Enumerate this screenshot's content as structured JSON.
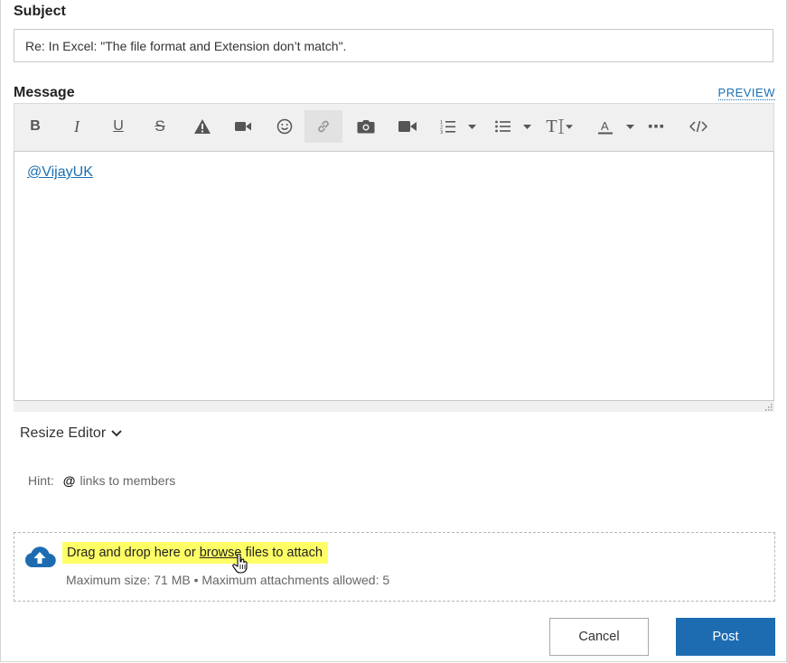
{
  "form": {
    "subject_label": "Subject",
    "subject_value": "Re: In Excel: \"The file format and Extension don’t match\".",
    "message_label": "Message",
    "preview_label": "PREVIEW"
  },
  "toolbar": {
    "items": [
      "bold",
      "italic",
      "underline",
      "strikethrough",
      "spoiler",
      "video",
      "emoji",
      "link",
      "photo",
      "video",
      "numbered-list",
      "bulleted-list",
      "text-size",
      "text-color",
      "more",
      "source-code"
    ],
    "bold": "B",
    "italic": "I",
    "underline": "U",
    "strike": "S",
    "text_size": "T"
  },
  "editor": {
    "mention": "@VijayUK"
  },
  "resize_editor_label": "Resize Editor",
  "hint": {
    "label": "Hint:",
    "symbol": "@",
    "text": "links to members"
  },
  "attach": {
    "text_before": "Drag and drop here or ",
    "browse": "browse",
    "text_after": " files to attach",
    "limits": "Maximum size: 71 MB • Maximum attachments allowed: 5"
  },
  "buttons": {
    "cancel": "Cancel",
    "post": "Post"
  },
  "colors": {
    "link": "#1a6fb5",
    "primary": "#1d6cb2",
    "highlight": "#ffff66"
  }
}
